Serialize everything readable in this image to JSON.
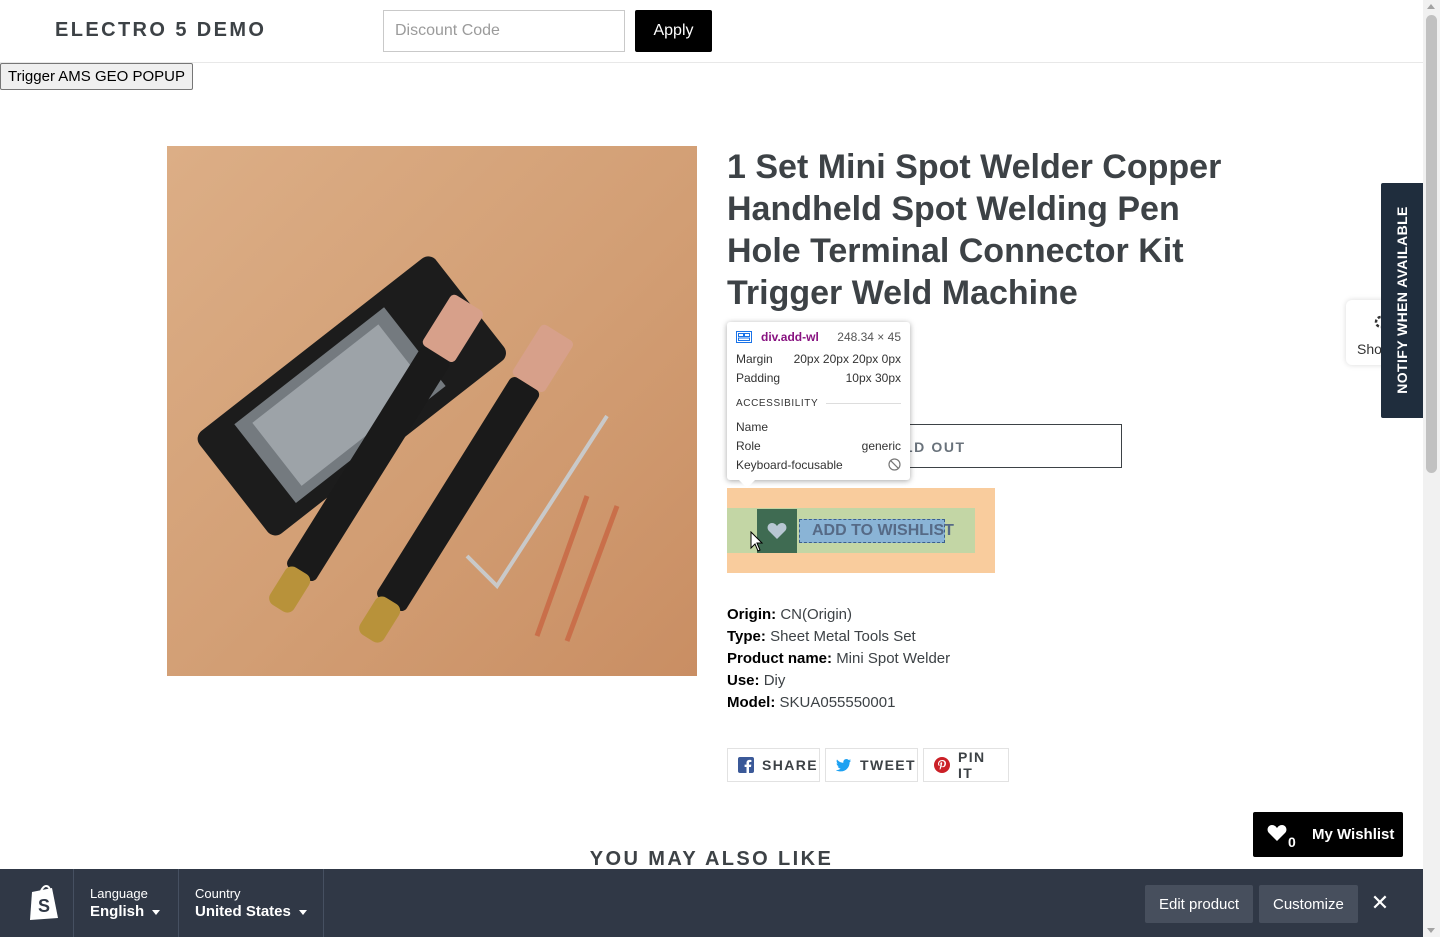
{
  "header": {
    "site_title": "ELECTRO 5 DEMO",
    "discount_placeholder": "Discount Code",
    "discount_value": "",
    "apply_label": "Apply",
    "geo_popup_label": "Trigger AMS GEO POPUP"
  },
  "product": {
    "title": "1 Set Mini Spot Welder Copper Handheld Spot Welding Pen Hole Terminal Connector Kit Trigger Weld Machine",
    "sold_out_label": "LD OUT",
    "wishlist_label": "ADD TO WISHLIST",
    "specs": [
      {
        "key": "Origin:",
        "value": "CN(Origin)"
      },
      {
        "key": "Type:",
        "value": "Sheet Metal Tools Set"
      },
      {
        "key": "Product name:",
        "value": "Mini Spot Welder"
      },
      {
        "key": "Use:",
        "value": "Diy"
      },
      {
        "key": "Model:",
        "value": "SKUA055550001"
      }
    ],
    "share": [
      {
        "label": "SHARE",
        "icon": "facebook-icon"
      },
      {
        "label": "TWEET",
        "icon": "twitter-icon"
      },
      {
        "label": "PIN IT",
        "icon": "pinterest-icon"
      }
    ]
  },
  "devtools_tooltip": {
    "selector": "div.add-wl",
    "size": "248.34 × 45",
    "margin_label": "Margin",
    "margin_value": "20px 20px 20px 0px",
    "padding_label": "Padding",
    "padding_value": "10px 30px",
    "section_label": "ACCESSIBILITY",
    "name_label": "Name",
    "name_value": "",
    "role_label": "Role",
    "role_value": "generic",
    "focusable_label": "Keyboard-focusable"
  },
  "notify_tab": {
    "label": "NOTIFY WHEN AVAILABLE"
  },
  "show_widget": {
    "label": "Sho"
  },
  "related": {
    "title": "YOU MAY ALSO LIKE"
  },
  "wishlist_float": {
    "count": "0",
    "label": "My Wishlist"
  },
  "bottom_bar": {
    "language_label": "Language",
    "language_value": "English",
    "country_label": "Country",
    "country_value": "United States",
    "edit_label": "Edit product",
    "customize_label": "Customize",
    "close_icon": "close-icon"
  },
  "colors": {
    "accent_black": "#000000",
    "bottom_bar": "#303846",
    "notify_tab": "#1f2d3d",
    "margin_overlay": "#f9cc9d",
    "padding_overlay": "#c3d6a5",
    "content_overlay": "#8ab4d6"
  }
}
